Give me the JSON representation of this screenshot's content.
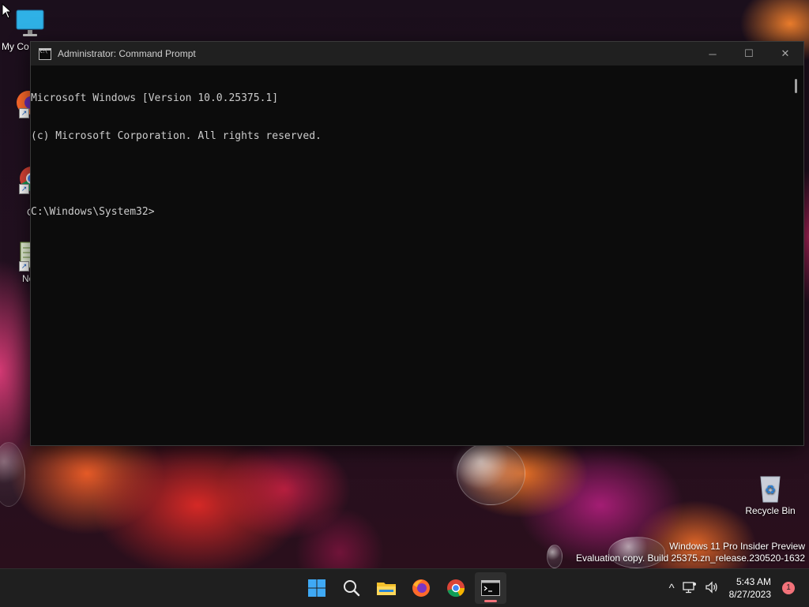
{
  "desktop": {
    "icons": [
      {
        "label": "My Co"
      },
      {
        "label": "Fire"
      },
      {
        "label": "Goo\nChro"
      },
      {
        "label": "Notep"
      },
      {
        "label": "Recycle Bin"
      }
    ]
  },
  "cmd": {
    "title": "Administrator: Command Prompt",
    "lines": [
      "Microsoft Windows [Version 10.0.25375.1]",
      "(c) Microsoft Corporation. All rights reserved.",
      "",
      "C:\\Windows\\System32>"
    ],
    "controls": {
      "minimize": "─",
      "maximize": "☐",
      "close": "✕"
    }
  },
  "watermark": {
    "line1": "Windows 11 Pro Insider Preview",
    "line2": "Evaluation copy. Build 25375.zn_release.230520-1632"
  },
  "taskbar": {
    "apps": [
      "start-icon",
      "search-icon",
      "file-explorer-icon",
      "firefox-icon",
      "chrome-icon",
      "terminal-icon"
    ],
    "active_app": "terminal-icon",
    "tray": {
      "chevron": "^",
      "time": "5:43 AM",
      "date": "8/27/2023",
      "notifications": "1"
    }
  },
  "colors": {
    "indicator": "#f2727a",
    "console_bg": "#0c0c0c",
    "console_text": "#cccccc"
  }
}
